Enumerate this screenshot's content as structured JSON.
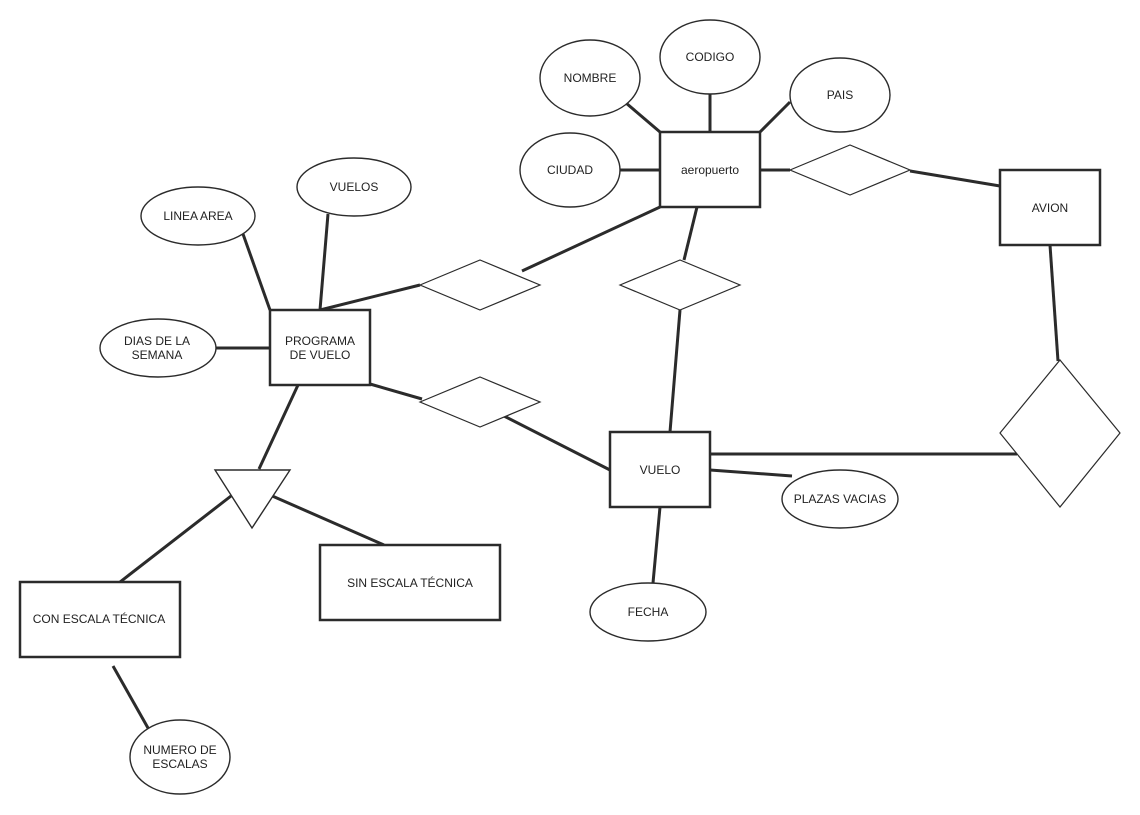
{
  "diagram": {
    "type": "entity-relationship",
    "entities": [
      {
        "id": "aeropuerto",
        "label": [
          "aeropuerto"
        ]
      },
      {
        "id": "avion",
        "label": [
          "AVION"
        ]
      },
      {
        "id": "programa",
        "label": [
          "PROGRAMA",
          "DE VUELO"
        ]
      },
      {
        "id": "vuelo",
        "label": [
          "VUELO"
        ]
      },
      {
        "id": "con_escala",
        "label": [
          "CON ESCALA TÉCNICA"
        ]
      },
      {
        "id": "sin_escala",
        "label": [
          "SIN ESCALA TÉCNICA"
        ]
      }
    ],
    "attributes": [
      {
        "id": "nombre",
        "label": [
          "NOMBRE"
        ],
        "of": "aeropuerto"
      },
      {
        "id": "codigo",
        "label": [
          "CODIGO"
        ],
        "of": "aeropuerto"
      },
      {
        "id": "pais",
        "label": [
          "PAIS"
        ],
        "of": "aeropuerto"
      },
      {
        "id": "ciudad",
        "label": [
          "CIUDAD"
        ],
        "of": "aeropuerto"
      },
      {
        "id": "linea_area",
        "label": [
          "LINEA AREA"
        ],
        "of": "programa"
      },
      {
        "id": "vuelos",
        "label": [
          "VUELOS"
        ],
        "of": "programa"
      },
      {
        "id": "dias",
        "label": [
          "DIAS DE LA",
          "SEMANA"
        ],
        "of": "programa"
      },
      {
        "id": "plazas",
        "label": [
          "PLAZAS VACIAS"
        ],
        "of": "vuelo"
      },
      {
        "id": "fecha",
        "label": [
          "FECHA"
        ],
        "of": "vuelo"
      },
      {
        "id": "num_escalas",
        "label": [
          "NUMERO DE",
          "ESCALAS"
        ],
        "of": "con_escala"
      }
    ],
    "relationships": [
      {
        "id": "rel_aeropuerto_avion",
        "label": "",
        "connects": [
          "aeropuerto",
          "avion"
        ]
      },
      {
        "id": "rel_programa_aeropuerto",
        "label": "",
        "connects": [
          "programa",
          "aeropuerto"
        ]
      },
      {
        "id": "rel_aeropuerto_vuelo",
        "label": "",
        "connects": [
          "aeropuerto",
          "vuelo"
        ]
      },
      {
        "id": "rel_programa_vuelo",
        "label": "",
        "connects": [
          "programa",
          "vuelo"
        ]
      },
      {
        "id": "rel_avion_vuelo",
        "label": "",
        "connects": [
          "avion",
          "vuelo"
        ]
      }
    ],
    "specializations": [
      {
        "id": "isa_programa",
        "parent": "programa",
        "children": [
          "con_escala",
          "sin_escala"
        ]
      }
    ],
    "colors": {
      "stroke": "#2b2b2b",
      "fill": "#ffffff",
      "text": "#222222"
    }
  }
}
